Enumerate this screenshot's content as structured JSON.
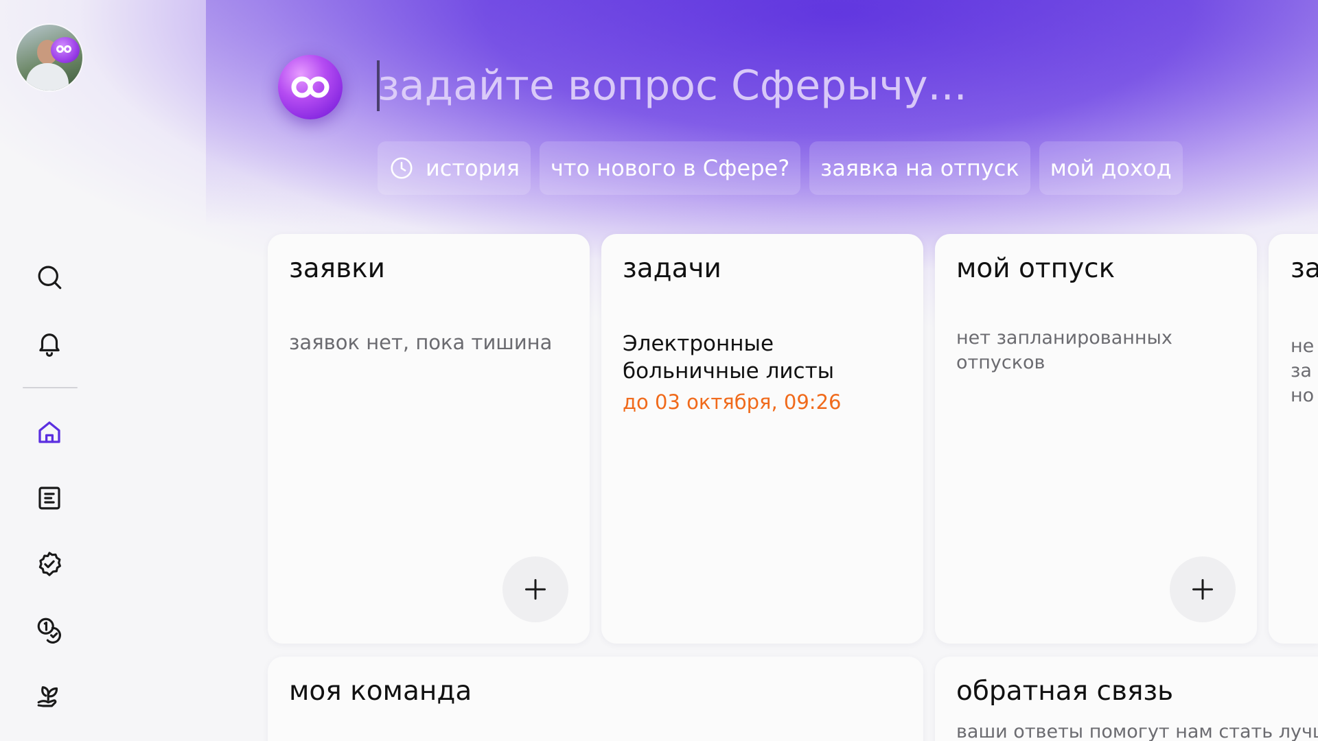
{
  "sidebar": {
    "items": [
      {
        "name": "search-icon"
      },
      {
        "name": "bell-icon"
      },
      {
        "name": "home-icon",
        "active": true
      },
      {
        "name": "document-list-icon"
      },
      {
        "name": "check-badge-icon"
      },
      {
        "name": "coins-icon"
      },
      {
        "name": "hand-leaf-icon"
      }
    ]
  },
  "search": {
    "placeholder": "задайте вопрос Сферычу...",
    "value": ""
  },
  "chips": [
    {
      "label": "история",
      "icon": "clock-icon"
    },
    {
      "label": "что нового в Сфере?"
    },
    {
      "label": "заявка на отпуск"
    },
    {
      "label": "мой доход"
    }
  ],
  "cards": {
    "requests": {
      "title": "заявки",
      "empty_text": "заявок нет, пока тишина"
    },
    "tasks": {
      "title": "задачи",
      "task_title": "Электронные больничные листы",
      "task_deadline": "до 03 октября, 09:26"
    },
    "vacation": {
      "title": "мой отпуск",
      "empty_text": "нет запланированных отпусков"
    },
    "fourth": {
      "title": "за",
      "text_lines": [
        "не",
        "за",
        "но"
      ]
    },
    "team": {
      "title": "моя команда"
    },
    "feedback": {
      "title": "обратная связь",
      "subtitle": "ваши ответы помогут нам стать лучш"
    }
  },
  "colors": {
    "accent": "#5b2fe0",
    "active_icon": "#5b2fe0",
    "deadline": "#f06a1b"
  }
}
